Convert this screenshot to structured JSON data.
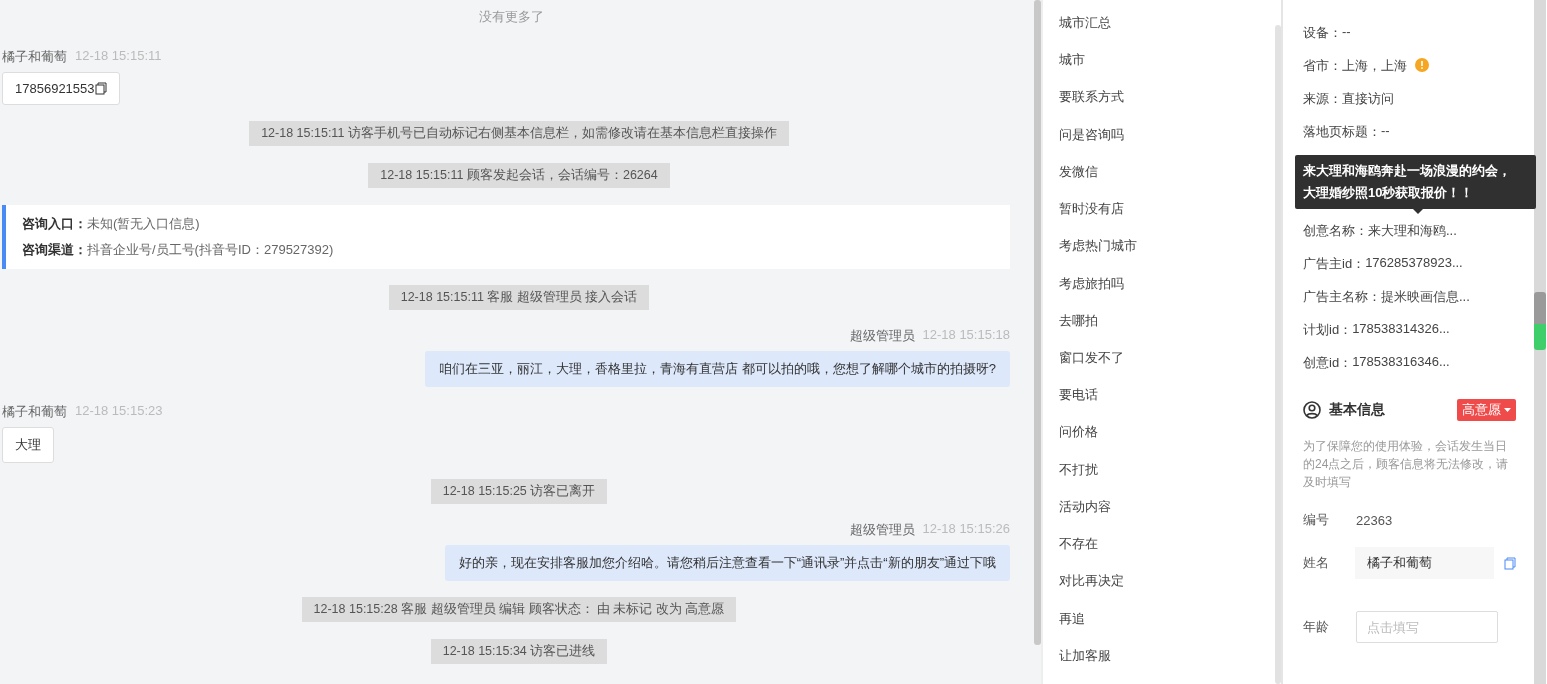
{
  "chat": {
    "entries": [
      {
        "kind": "note",
        "text": "没有更多了"
      },
      {
        "kind": "customer",
        "name": "橘子和葡萄",
        "time": "12-18 15:15:11",
        "text": "17856921553",
        "copyable": true
      },
      {
        "kind": "system",
        "text": "12-18 15:15:11 访客手机号已自动标记右侧基本信息栏，如需修改请在基本信息栏直接操作"
      },
      {
        "kind": "system",
        "text": "12-18 15:15:11 顾客发起会话，会话编号：26264"
      },
      {
        "kind": "info",
        "lines": [
          {
            "label": "咨询入口：",
            "value": "未知(暂无入口信息)"
          },
          {
            "label": "咨询渠道：",
            "value": "抖音企业号/员工号(抖音号ID：279527392)"
          }
        ]
      },
      {
        "kind": "system",
        "text": "12-18 15:15:11 客服 超级管理员 接入会话"
      },
      {
        "kind": "agent",
        "name": "超级管理员",
        "time": "12-18 15:15:18",
        "text": "咱们在三亚，丽江，大理，香格里拉，青海有直营店 都可以拍的哦，您想了解哪个城市的拍摄呀?"
      },
      {
        "kind": "customer",
        "name": "橘子和葡萄",
        "time": "12-18 15:15:23",
        "text": "大理",
        "copyable": false
      },
      {
        "kind": "system",
        "text": "12-18 15:15:25 访客已离开"
      },
      {
        "kind": "agent",
        "name": "超级管理员",
        "time": "12-18 15:15:26",
        "text": "好的亲，现在安排客服加您介绍哈。请您稍后注意查看一下“通讯录”并点击“新的朋友”通过下哦"
      },
      {
        "kind": "system",
        "text": "12-18 15:15:28 客服 超级管理员 编辑 顾客状态： 由 未标记 改为 高意愿"
      },
      {
        "kind": "system",
        "text": "12-18 15:15:34 访客已进线"
      }
    ]
  },
  "quick_replies": [
    "城市汇总",
    "城市",
    "要联系方式",
    "问是咨询吗",
    "发微信",
    "暂时没有店",
    "考虑热门城市",
    "考虑旅拍吗",
    "去哪拍",
    "窗口发不了",
    "要电话",
    "问价格",
    "不打扰",
    "活动内容",
    "不存在",
    "对比再决定",
    "再追",
    "让加客服"
  ],
  "details": {
    "rows_top": [
      {
        "label": "设备：",
        "value": "--",
        "alert": false
      },
      {
        "label": "省市：",
        "value": "上海，上海",
        "alert": true
      },
      {
        "label": "来源：",
        "value": "直接访问",
        "alert": false
      },
      {
        "label": "落地页标题：",
        "value": "--",
        "alert": false
      }
    ],
    "tooltip": "来大理和海鸥奔赴一场浪漫的约会，大理婚纱照10秒获取报价！！",
    "rows_bottom": [
      {
        "label": "创意名称：",
        "value": "来大理和海鸥...",
        "alert": false
      },
      {
        "label": "广告主id：",
        "value": "176285378923...",
        "alert": false
      },
      {
        "label": "广告主名称：",
        "value": "提米映画信息...",
        "alert": false
      },
      {
        "label": "计划id：",
        "value": "178538314326...",
        "alert": false
      },
      {
        "label": "创意id：",
        "value": "178538316346...",
        "alert": false
      }
    ]
  },
  "basic_info": {
    "title": "基本信息",
    "tag": "高意愿",
    "notice": "为了保障您的使用体验，会话发生当日的24点之后，顾客信息将无法修改，请及时填写",
    "fields": [
      {
        "kind": "text",
        "label": "编号",
        "value": "22363"
      },
      {
        "kind": "filled",
        "label": "姓名",
        "value": "橘子和葡萄"
      },
      {
        "kind": "input",
        "label": "年龄",
        "placeholder": "点击填写"
      }
    ]
  }
}
